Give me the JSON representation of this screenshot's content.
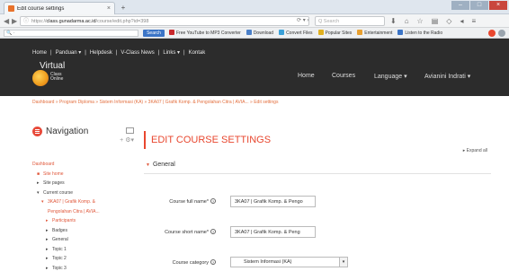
{
  "browser": {
    "tab_title": "Edit course settings",
    "tab_close": "×",
    "new_tab": "+",
    "url_prefix": "https://",
    "url_host": "class.gunadarma.ac.id",
    "url_path": "/course/edit.php?id=398",
    "search_placeholder": "Q Search",
    "window_controls": {
      "minimize": "–",
      "maximize": "□",
      "close": "×"
    }
  },
  "toolbar": {
    "search_value": "🔍 ·",
    "search_button": "Search",
    "items": [
      {
        "label": "Free YouTube to MP3 Converter",
        "color": "#c8282c"
      },
      {
        "label": "Download",
        "color": "#4a7fc8"
      },
      {
        "label": "Convert Files",
        "color": "#3aa0d8"
      },
      {
        "label": "Popular Sites",
        "color": "#e0b020"
      },
      {
        "label": "Entertainment",
        "color": "#e8a030"
      },
      {
        "label": "Listen to the Radio",
        "color": "#3b74c6"
      }
    ],
    "right_icons": [
      {
        "name": "red-circle-icon",
        "color": "#e8472f"
      },
      {
        "name": "checkmark-icon",
        "color": "#9aa4ae"
      }
    ]
  },
  "site": {
    "top_menu": [
      "Home",
      "|",
      "Panduan ▾",
      "|",
      "Helpdesk",
      "|",
      "V-Class News",
      "|",
      "Links ▾",
      "|",
      "Kontak"
    ],
    "logo_line1": "Virtual",
    "logo_line2": "Class",
    "logo_line3": "Online",
    "nav": {
      "home": "Home",
      "courses": "Courses",
      "language": "Language ▾",
      "user": "Avianini Indrati ▾"
    }
  },
  "breadcrumb": "Dashboard » Program Diploma » Sistem Informasi (KA) » 3KA07 | Grafik Komp. & Pengolahan Citra | AVIA... » Edit settings",
  "navigation": {
    "title": "Navigation",
    "tree": [
      {
        "text": "Dashboard",
        "color": "red",
        "indent": 0,
        "bullet": ""
      },
      {
        "text": "Site home",
        "color": "red",
        "indent": 5,
        "bullet": "■"
      },
      {
        "text": "Site pages",
        "color": "black",
        "indent": 5,
        "bullet": "▸"
      },
      {
        "text": "Current course",
        "color": "black",
        "indent": 5,
        "bullet": "▾"
      },
      {
        "text": "3KA07 | Grafik Komp. &",
        "color": "red",
        "indent": 10,
        "bullet": "▾"
      },
      {
        "text": "Pengolahan Citra | AVIA...",
        "color": "red",
        "indent": 10,
        "bullet": ""
      },
      {
        "text": "Participants",
        "color": "red",
        "indent": 15,
        "bullet": "▸"
      },
      {
        "text": "Badges",
        "color": "black",
        "indent": 15,
        "bullet": "▸"
      },
      {
        "text": "General",
        "color": "black",
        "indent": 15,
        "bullet": "▸"
      },
      {
        "text": "Topic 1",
        "color": "black",
        "indent": 15,
        "bullet": "▸"
      },
      {
        "text": "Topic 2",
        "color": "black",
        "indent": 15,
        "bullet": "▸"
      },
      {
        "text": "Topic 3",
        "color": "black",
        "indent": 15,
        "bullet": "▸"
      }
    ]
  },
  "main": {
    "title": "EDIT COURSE SETTINGS",
    "expand_all": "Expand all",
    "section": "General",
    "fields": [
      {
        "label": "Course full name*",
        "value": "3KA07 | Grafik Komp. & Pengo",
        "type": "text"
      },
      {
        "label": "Course short name*",
        "value": "3KA07 | Grafik Komp. & Peng",
        "type": "text"
      },
      {
        "label": "Course category",
        "value": "Sistem Informasi (KA)",
        "type": "select"
      }
    ]
  },
  "colors": {
    "accent": "#e8472f",
    "topbar": "#2c2c2c"
  }
}
